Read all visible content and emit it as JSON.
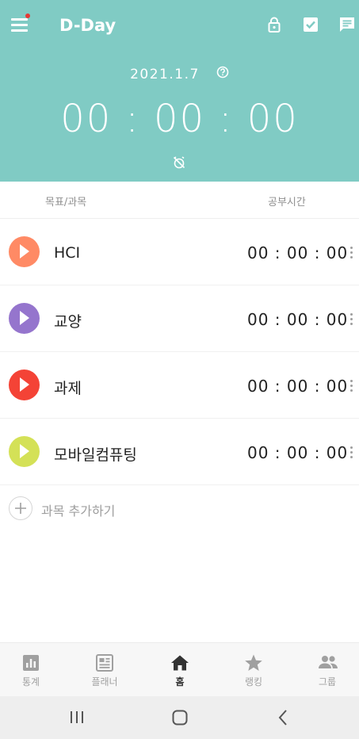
{
  "header": {
    "title": "D-Day",
    "date": "2021.1.7",
    "timer": "00 : 00 : 00",
    "icons": [
      "menu-icon",
      "lock-icon",
      "checkbox-icon",
      "message-icon",
      "help-icon",
      "alarm-off-icon"
    ]
  },
  "columns": {
    "left": "목표/과목",
    "right": "공부시간"
  },
  "subjects": [
    {
      "name": "HCI",
      "time": "00 : 00 : 00",
      "color": "#ff8a65"
    },
    {
      "name": "교양",
      "time": "00 : 00 : 00",
      "color": "#9575cd"
    },
    {
      "name": "과제",
      "time": "00 : 00 : 00",
      "color": "#f44336"
    },
    {
      "name": "모바일컴퓨팅",
      "time": "00 : 00 : 00",
      "color": "#d4e157"
    }
  ],
  "add_subject": {
    "label": "과목 추가하기"
  },
  "bottom_nav": {
    "items": [
      {
        "label": "통계",
        "icon": "stats-icon"
      },
      {
        "label": "플래너",
        "icon": "planner-icon"
      },
      {
        "label": "홈",
        "icon": "home-icon",
        "active": true
      },
      {
        "label": "랭킹",
        "icon": "star-icon"
      },
      {
        "label": "그룹",
        "icon": "group-icon"
      }
    ]
  },
  "colors": {
    "header_bg": "#80cbc4",
    "nav_active": "#333333",
    "nav_inactive": "#a0a0a0"
  }
}
